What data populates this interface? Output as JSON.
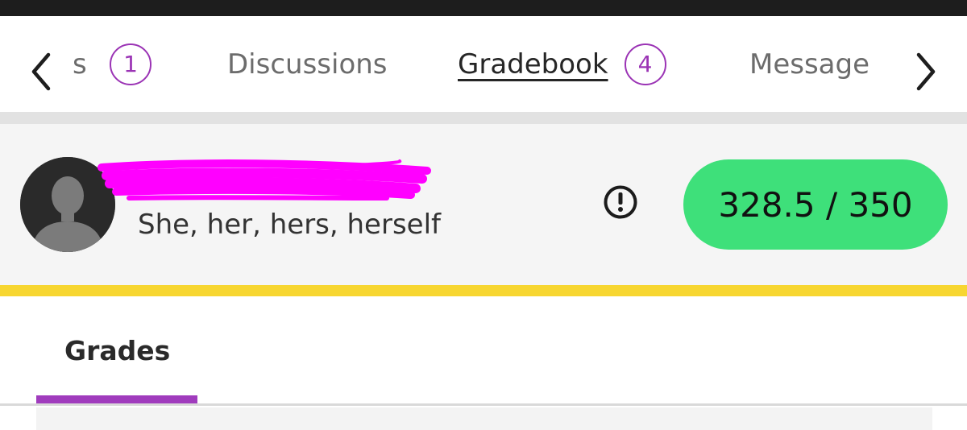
{
  "colors": {
    "accent": "#9b34b5",
    "grade_pill": "#3ee07a",
    "highlight_bar": "#f7d631",
    "redaction": "#ff00ff"
  },
  "nav": {
    "prev_icon": "chevron-left-icon",
    "next_icon": "chevron-right-icon",
    "tabs": [
      {
        "label": "s",
        "count": "1"
      },
      {
        "label": "Discussions"
      },
      {
        "label": "Gradebook",
        "count": "4",
        "active": true
      },
      {
        "label": "Message"
      }
    ]
  },
  "student": {
    "avatar_icon": "person-silhouette-icon",
    "pronouns": "She, her, hers, herself",
    "alert_icon": "exclamation-circle-icon",
    "grade": "328.5 / 350"
  },
  "subtabs": {
    "grades_label": "Grades"
  }
}
